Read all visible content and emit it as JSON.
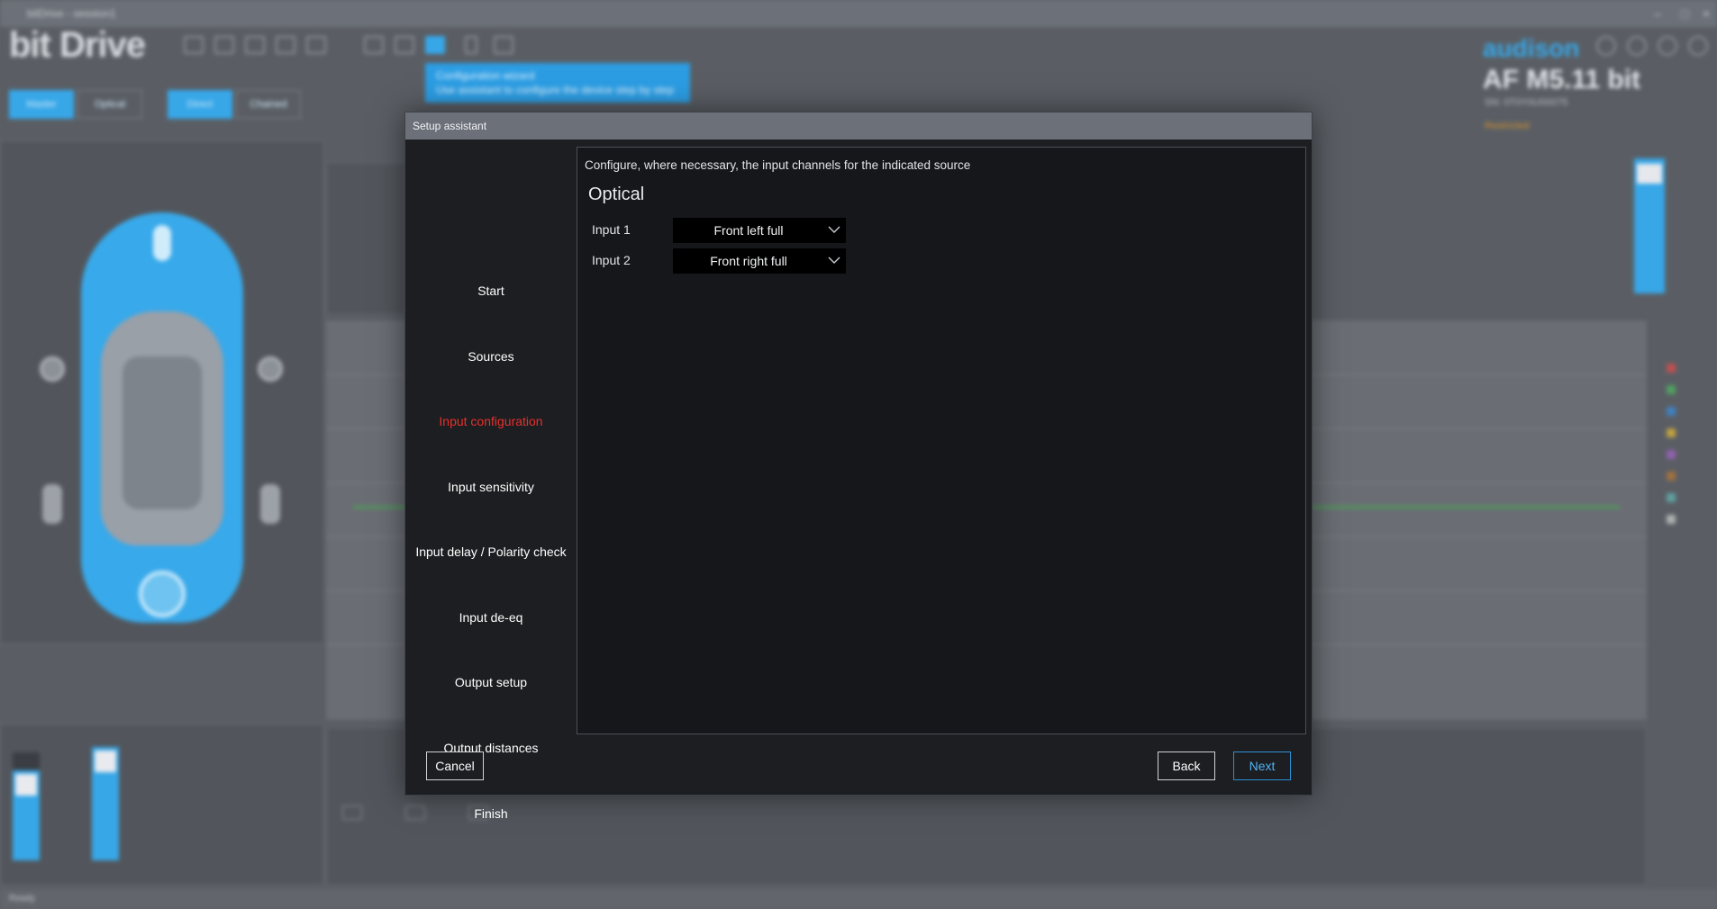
{
  "background": {
    "window_title": "bitDrive - session1",
    "app_logo": "bit Drive",
    "brand": "audison",
    "model": "AF M5.11 bit",
    "model_sub": "SN: 0T0Y0U00075",
    "model_status": "Restricted",
    "tooltip_title": "Configuration wizard",
    "tooltip_text": "Use assistant to configure the device step by step",
    "pills": [
      "Master",
      "Optical",
      "Direct",
      "Chained"
    ],
    "toolbar_icons": [
      "new-icon",
      "open-icon",
      "save-icon",
      "upload-icon",
      "download-icon",
      "layout-icon",
      "tools-icon",
      "wizard-icon",
      "lock-icon",
      "video-icon"
    ],
    "status_text": "Ready",
    "colors": {
      "accent": "#37a7e8",
      "bg": "#5a5e64"
    }
  },
  "dialog": {
    "title": "Setup assistant",
    "steps": [
      {
        "id": "start",
        "label": "Start"
      },
      {
        "id": "sources",
        "label": "Sources"
      },
      {
        "id": "input-configuration",
        "label": "Input configuration",
        "active": true
      },
      {
        "id": "input-sensitivity",
        "label": "Input sensitivity"
      },
      {
        "id": "input-delay-polarity",
        "label": "Input delay / Polarity check"
      },
      {
        "id": "input-de-eq",
        "label": "Input de-eq"
      },
      {
        "id": "output-setup",
        "label": "Output setup"
      },
      {
        "id": "output-distances",
        "label": "Output distances"
      },
      {
        "id": "finish",
        "label": "Finish"
      }
    ],
    "hint": "Configure, where necessary, the input channels for the indicated source",
    "source_title": "Optical",
    "inputs": [
      {
        "label": "Input 1",
        "value": "Front left full"
      },
      {
        "label": "Input 2",
        "value": "Front right full"
      }
    ],
    "buttons": {
      "cancel": "Cancel",
      "back": "Back",
      "next": "Next"
    },
    "colors": {
      "active_step": "#e8302c",
      "primary_button": "#4fb3f6",
      "panel_bg": "#15171a"
    }
  }
}
